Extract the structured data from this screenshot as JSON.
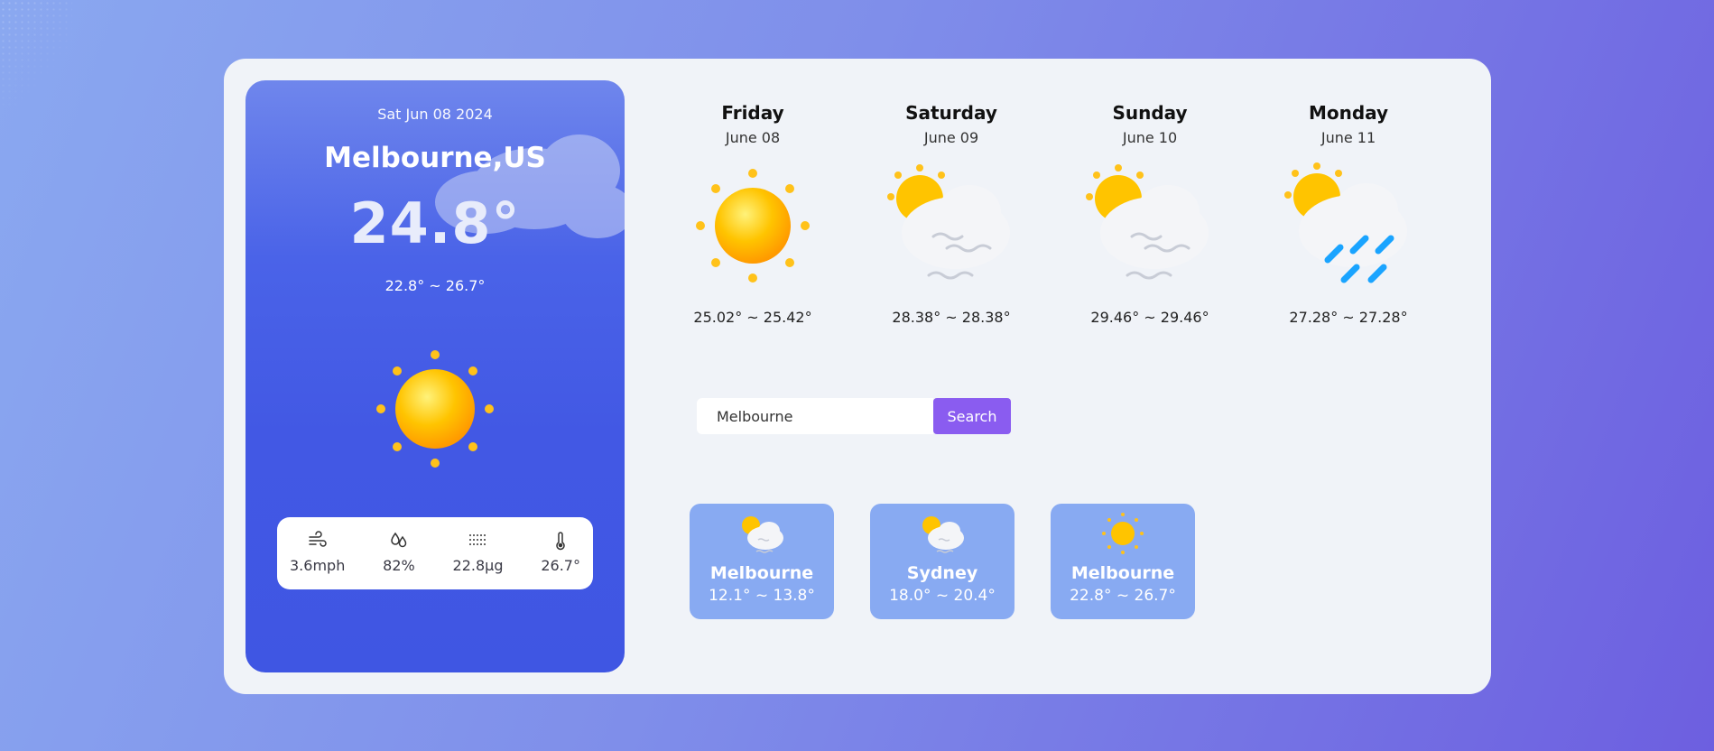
{
  "current": {
    "date": "Sat Jun 08 2024",
    "city": "Melbourne,US",
    "temp": "24.8°",
    "range": "22.8° ~ 26.7°",
    "icon": "sun-icon",
    "stats": [
      {
        "icon": "wind-icon",
        "value": "3.6mph"
      },
      {
        "icon": "humidity-icon",
        "value": "82%"
      },
      {
        "icon": "haze-icon",
        "value": "22.8μg"
      },
      {
        "icon": "thermometer-icon",
        "value": "26.7°"
      }
    ]
  },
  "forecast": [
    {
      "day": "Friday",
      "date": "June 08",
      "icon": "sun-icon",
      "range": "25.02° ~ 25.42°"
    },
    {
      "day": "Saturday",
      "date": "June 09",
      "icon": "fog-cloud-icon",
      "range": "28.38° ~ 28.38°"
    },
    {
      "day": "Sunday",
      "date": "June 10",
      "icon": "fog-cloud-icon",
      "range": "29.46° ~ 29.46°"
    },
    {
      "day": "Monday",
      "date": "June 11",
      "icon": "rain-cloud-icon",
      "range": "27.28° ~ 27.28°"
    }
  ],
  "search": {
    "value": "Melbourne",
    "button": "Search"
  },
  "cities": [
    {
      "name": "Melbourne",
      "range": "12.1° ~ 13.8°",
      "icon": "fog-cloud-icon"
    },
    {
      "name": "Sydney",
      "range": "18.0° ~ 20.4°",
      "icon": "fog-cloud-icon"
    },
    {
      "name": "Melbourne",
      "range": "22.8° ~ 26.7°",
      "icon": "sun-icon"
    }
  ],
  "colors": {
    "accent": "#8a5cf0",
    "card": "#4258e4",
    "city_card": "#88aaf2"
  }
}
